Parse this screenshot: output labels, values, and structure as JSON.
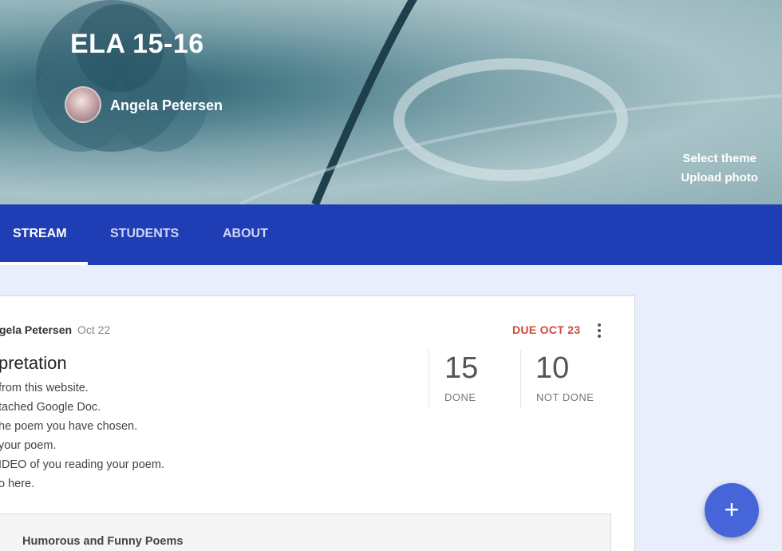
{
  "header": {
    "class_title": "ELA 15-16",
    "teacher_name": "Angela Petersen",
    "select_theme": "Select theme",
    "upload_photo": "Upload photo"
  },
  "tabs": [
    {
      "label": "STREAM",
      "active": true
    },
    {
      "label": "STUDENTS",
      "active": false
    },
    {
      "label": "ABOUT",
      "active": false
    }
  ],
  "post": {
    "author": "gela Petersen",
    "date": "Oct 22",
    "due": "DUE OCT 23",
    "title": "pretation",
    "lines": [
      "from this website.",
      "tached Google Doc.",
      "he poem you have chosen.",
      "your poem.",
      "IDEO of you reading your poem.",
      "o here."
    ],
    "stats": {
      "done_count": "15",
      "done_label": "DONE",
      "not_done_count": "10",
      "not_done_label": "NOT DONE"
    },
    "attachment_title": "Humorous and Funny Poems"
  },
  "fab": {
    "icon": "plus-icon",
    "glyph": "+"
  },
  "colors": {
    "tab_bar": "#1f3db5",
    "due": "#d04a3a",
    "fab": "#4565d8",
    "background": "#e8eefc"
  }
}
